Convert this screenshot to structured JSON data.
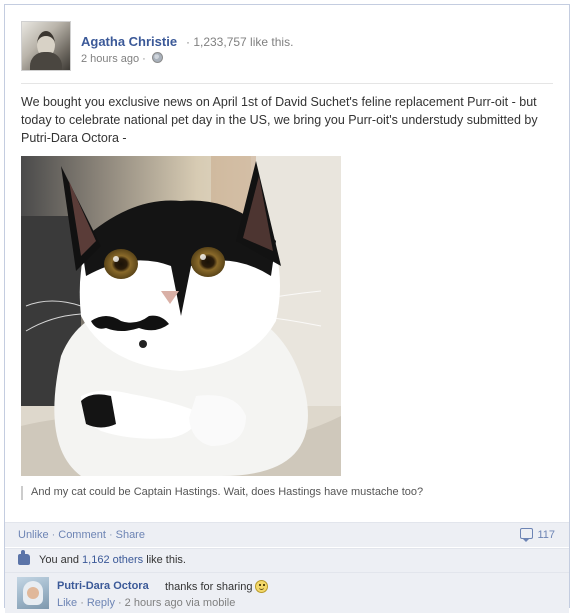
{
  "post": {
    "author": "Agatha Christie",
    "likes_summary": "· 1,233,757 like this.",
    "time": "2 hours ago",
    "meta_sep": "·",
    "privacy_icon": "globe-icon",
    "text": "We bought you exclusive news on April 1st of David Suchet's feline replacement Purr-oit - but today to celebrate national pet day in the US, we bring you Purr-oit's understudy submitted by Putri-Dara Octora -",
    "caption": "And my cat could be Captain Hastings. Wait, does Hastings have mustache too?"
  },
  "actions": {
    "unlike": "Unlike",
    "comment": "Comment",
    "share": "Share",
    "sep": "·",
    "comment_count": "117"
  },
  "likes": {
    "prefix": "You and ",
    "others_link": "1,162 others",
    "suffix": " like this."
  },
  "comment": {
    "author": "Putri-Dara Octora",
    "text": "thanks for sharing",
    "like": "Like",
    "reply": "Reply",
    "time": "2 hours ago via mobile",
    "sep": "·"
  },
  "colors": {
    "link": "#3b5998",
    "action_link": "#6d84b4",
    "ufi_background": "#edeff4"
  }
}
